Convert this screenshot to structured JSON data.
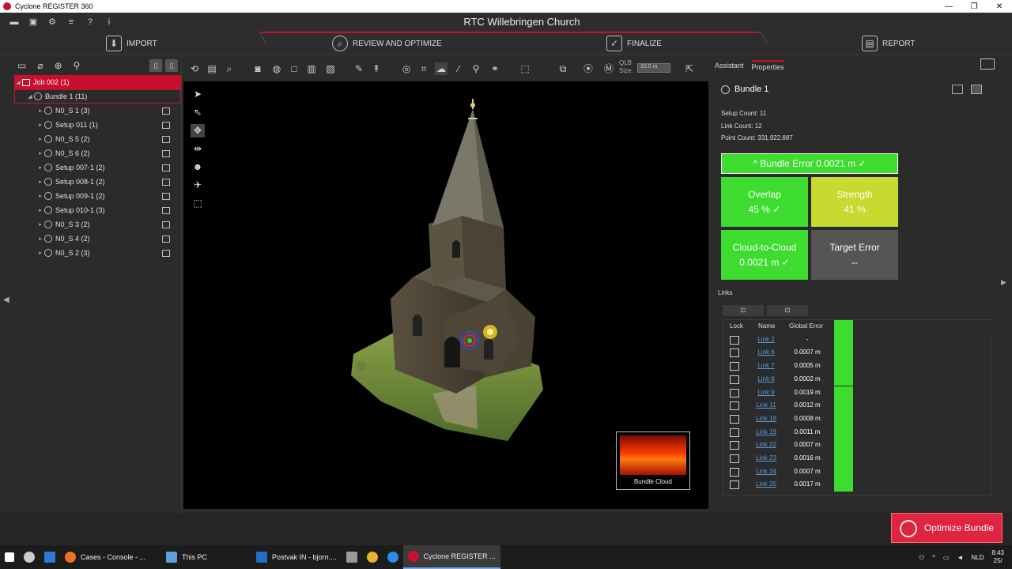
{
  "window": {
    "title": "Cyclone REGISTER 360"
  },
  "project": {
    "name": "RTC Willebringen Church"
  },
  "workflow": {
    "steps": [
      {
        "label": "IMPORT"
      },
      {
        "label": "REVIEW AND OPTIMIZE"
      },
      {
        "label": "FINALIZE"
      },
      {
        "label": "REPORT"
      }
    ]
  },
  "tree": {
    "job": "Job 002 (1)",
    "bundle": "Bundle 1 (11)",
    "setups": [
      "N0_S 1 (3)",
      "Setup 011 (1)",
      "N0_S 5 (2)",
      "N0_S 6 (2)",
      "Setup 007-1 (2)",
      "Setup 008-1 (2)",
      "Setup 009-1 (2)",
      "Setup 010-1 (3)",
      "N0_S 3 (2)",
      "N0_S 4 (2)",
      "N0_S 2 (3)"
    ]
  },
  "toolbar": {
    "qlb_label": "QLB",
    "size_label": "Size:",
    "size_value": "10.0 m"
  },
  "viewer": {
    "bundle_cloud_label": "Bundle Cloud"
  },
  "panel": {
    "tabs": [
      "Assistant",
      "Properties"
    ],
    "bundle_name": "Bundle 1",
    "stats": {
      "setup_count": "Setup Count:  11",
      "link_count": "Link Count:   12",
      "point_count": "Point Count:  331.922.887"
    },
    "bundle_error": "^ Bundle Error 0.0021 m    ✓",
    "tiles": {
      "overlap_title": "Overlap",
      "overlap_value": "45 %   ✓",
      "strength_title": "Strength",
      "strength_value": "41 %",
      "c2c_title": "Cloud-to-Cloud",
      "c2c_value": "0.0021 m   ✓",
      "target_title": "Target Error",
      "target_value": "--"
    },
    "links_label": "Links",
    "links_headers": {
      "lock": "Lock",
      "name": "Name",
      "error": "Global Error"
    },
    "links": [
      {
        "name": "Link 2",
        "error": "-"
      },
      {
        "name": "Link 6",
        "error": "0.0007 m"
      },
      {
        "name": "Link 7",
        "error": "0.0005 m"
      },
      {
        "name": "Link 8",
        "error": "0.0002 m"
      },
      {
        "name": "Link 9",
        "error": "0.0019 m"
      },
      {
        "name": "Link 11",
        "error": "0.0012 m"
      },
      {
        "name": "Link 18",
        "error": "0.0008 m"
      },
      {
        "name": "Link 19",
        "error": "0.0011 m"
      },
      {
        "name": "Link 22",
        "error": "0.0007 m"
      },
      {
        "name": "Link 23",
        "error": "0.0016 m"
      },
      {
        "name": "Link 24",
        "error": "0.0007 m"
      },
      {
        "name": "Link 25",
        "error": "0.0017 m"
      }
    ],
    "optimize_label": "Optimize Bundle"
  },
  "taskbar": {
    "items": [
      "Cases - Console - ...",
      "This PC",
      "Postvak IN - bjorn....",
      "Cyclone REGISTER ..."
    ],
    "lang": "NLD",
    "time": "8:43",
    "date": "25/"
  },
  "colors": {
    "accent": "#c8102e",
    "ok_green": "#3ddc2e",
    "warn_yellow": "#c8d92f",
    "link_blue": "#5a9bd6"
  }
}
